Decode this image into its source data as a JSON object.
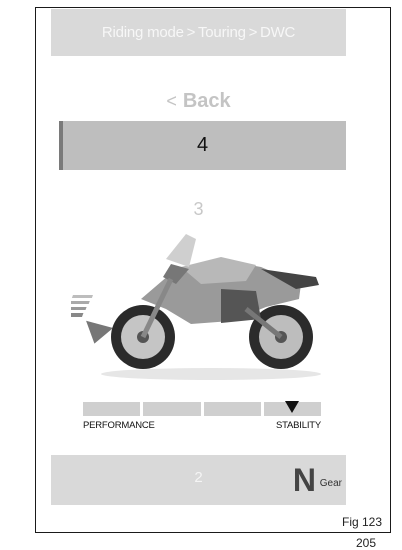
{
  "breadcrumb": "Riding mode > Touring > DWC",
  "back_label": "Back",
  "selected_value": "4",
  "next_value": "3",
  "prev_value": "2",
  "scale": {
    "left_label": "PERFORMANCE",
    "right_label": "STABILITY",
    "segments": 4,
    "active_segment": 4
  },
  "gear": {
    "value": "N",
    "label": "Gear"
  },
  "figure_caption": "Fig 123",
  "page_number": "205",
  "icons": [
    "chevron-left-icon",
    "motorcycle-image",
    "downward-arrow-icon",
    "triangle-indicator-icon"
  ]
}
